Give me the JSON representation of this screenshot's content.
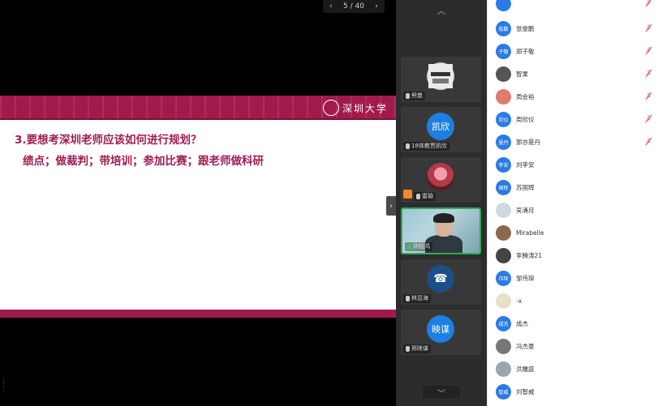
{
  "pager": {
    "prev": "‹",
    "text": "5 / 40",
    "next": "›"
  },
  "slide": {
    "logo_text": "深圳大学",
    "question": "3.要想考深圳老师应该如何进行规划？",
    "answer": "绩点；做裁判；带培训；参加比赛；跟老师做科研"
  },
  "video_panel": {
    "up": "︿",
    "down": "﹀",
    "collapse": "›",
    "tiles": [
      {
        "name": "熊敦",
        "avatar": "",
        "avatar_color": "#d9d9d9",
        "type": "image"
      },
      {
        "name": "18体教贾凯欣",
        "avatar": "凯欣",
        "avatar_color": "#1d7fe0",
        "type": "text"
      },
      {
        "name": "雷瑜",
        "avatar": "",
        "avatar_color": "#c0505c",
        "type": "image"
      },
      {
        "name": "钟程鸿",
        "avatar": "",
        "avatar_color": "",
        "type": "video"
      },
      {
        "name": "林显海",
        "avatar": "☎",
        "avatar_color": "#1c4e8a",
        "type": "text"
      },
      {
        "name": "邢映谋",
        "avatar": "映谋",
        "avatar_color": "#1d7fe0",
        "type": "text"
      }
    ]
  },
  "participants": [
    {
      "name": "",
      "avatar": "",
      "color": "#2c7be5",
      "muted": true
    },
    {
      "name": "张俊鹏",
      "avatar": "俊鹏",
      "color": "#2c7be5",
      "muted": true
    },
    {
      "name": "郑子敬",
      "avatar": "子敬",
      "color": "#2c7be5",
      "muted": true
    },
    {
      "name": "智果",
      "avatar": "",
      "color": "#555555",
      "muted": true
    },
    {
      "name": "周会裕",
      "avatar": "",
      "color": "#e07a6a",
      "muted": true
    },
    {
      "name": "周欣仪",
      "avatar": "欣仪",
      "color": "#2c7be5",
      "muted": true
    },
    {
      "name": "郭亦曼丹",
      "avatar": "曼丹",
      "color": "#2c7be5",
      "muted": true
    },
    {
      "name": "刘李安",
      "avatar": "李安",
      "color": "#2c7be5",
      "muted": false
    },
    {
      "name": "苏国辉",
      "avatar": "国辉",
      "color": "#2c7be5",
      "muted": false
    },
    {
      "name": "吴涌月",
      "avatar": "",
      "color": "#cfd8dc",
      "muted": false
    },
    {
      "name": "Mirabelle",
      "avatar": "",
      "color": "#8a6a4a",
      "muted": false
    },
    {
      "name": "李腾涛21",
      "avatar": "",
      "color": "#444444",
      "muted": false
    },
    {
      "name": "邹伟琛",
      "avatar": "伟琛",
      "color": "#2c7be5",
      "muted": false
    },
    {
      "name": "-x",
      "avatar": "",
      "color": "#e8e0c8",
      "muted": false
    },
    {
      "name": "成杰",
      "avatar": "成杰",
      "color": "#2c7be5",
      "muted": false
    },
    {
      "name": "冯杰豪",
      "avatar": "",
      "color": "#777777",
      "muted": false
    },
    {
      "name": "洪雕庭",
      "avatar": "",
      "color": "#9aa5ad",
      "muted": false
    },
    {
      "name": "刘智威",
      "avatar": "智威",
      "color": "#2c7be5",
      "muted": false
    }
  ]
}
